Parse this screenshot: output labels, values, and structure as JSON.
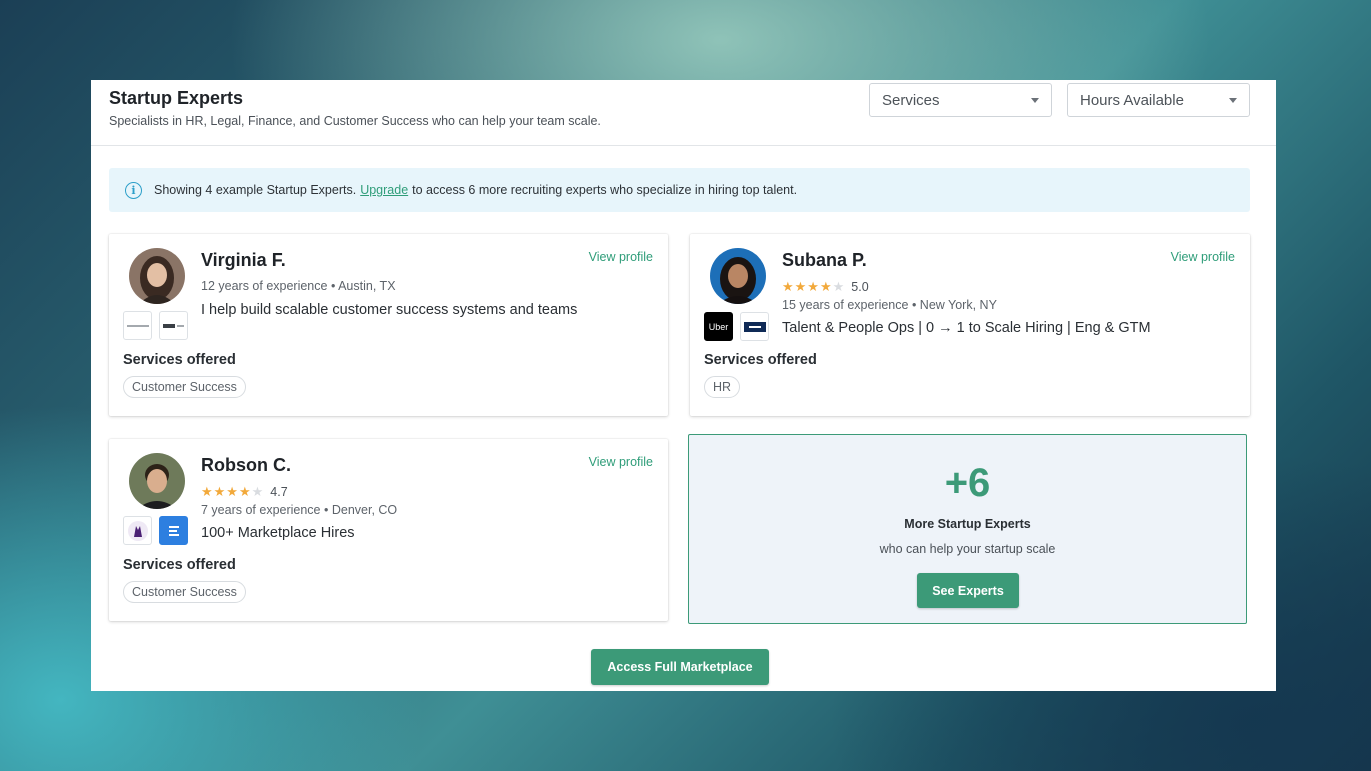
{
  "header": {
    "title": "Startup Experts",
    "subtitle": "Specialists in HR, Legal, Finance, and Customer Success who can help your team scale.",
    "filters": [
      {
        "label": "Services"
      },
      {
        "label": "Hours Available"
      }
    ]
  },
  "banner": {
    "prefix": "Showing 4 example Startup Experts.",
    "link": "Upgrade",
    "suffix": "to access 6 more recruiting experts who specialize in hiring top talent."
  },
  "experts": [
    {
      "name": "Virginia F.",
      "view_profile": "View profile",
      "meta": "12 years of experience • Austin, TX",
      "headline": "I help build scalable customer success systems and teams",
      "services_label": "Services offered",
      "services": [
        "Customer Success"
      ]
    },
    {
      "name": "Subana P.",
      "view_profile": "View profile",
      "rating": "5.0",
      "meta": "15 years of experience • New York, NY",
      "headline": "Talent & People Ops | 0 → 1 to Scale Hiring | Eng & GTM",
      "logo_text": "Uber",
      "services_label": "Services offered",
      "services": [
        "HR"
      ]
    },
    {
      "name": "Robson C.",
      "view_profile": "View profile",
      "rating": "4.7",
      "meta": "7 years of experience • Denver, CO",
      "headline": "100+ Marketplace Hires",
      "services_label": "Services offered",
      "services": [
        "Customer Success"
      ]
    }
  ],
  "more": {
    "count": "+6",
    "title": "More Startup Experts",
    "subtitle": "who can help your startup scale",
    "button": "See Experts"
  },
  "footer": {
    "button": "Access Full Marketplace"
  },
  "colors": {
    "accent": "#3c9a78",
    "star": "#f2a93b",
    "banner_bg": "#e7f5fb",
    "info": "#2c9fc9"
  }
}
